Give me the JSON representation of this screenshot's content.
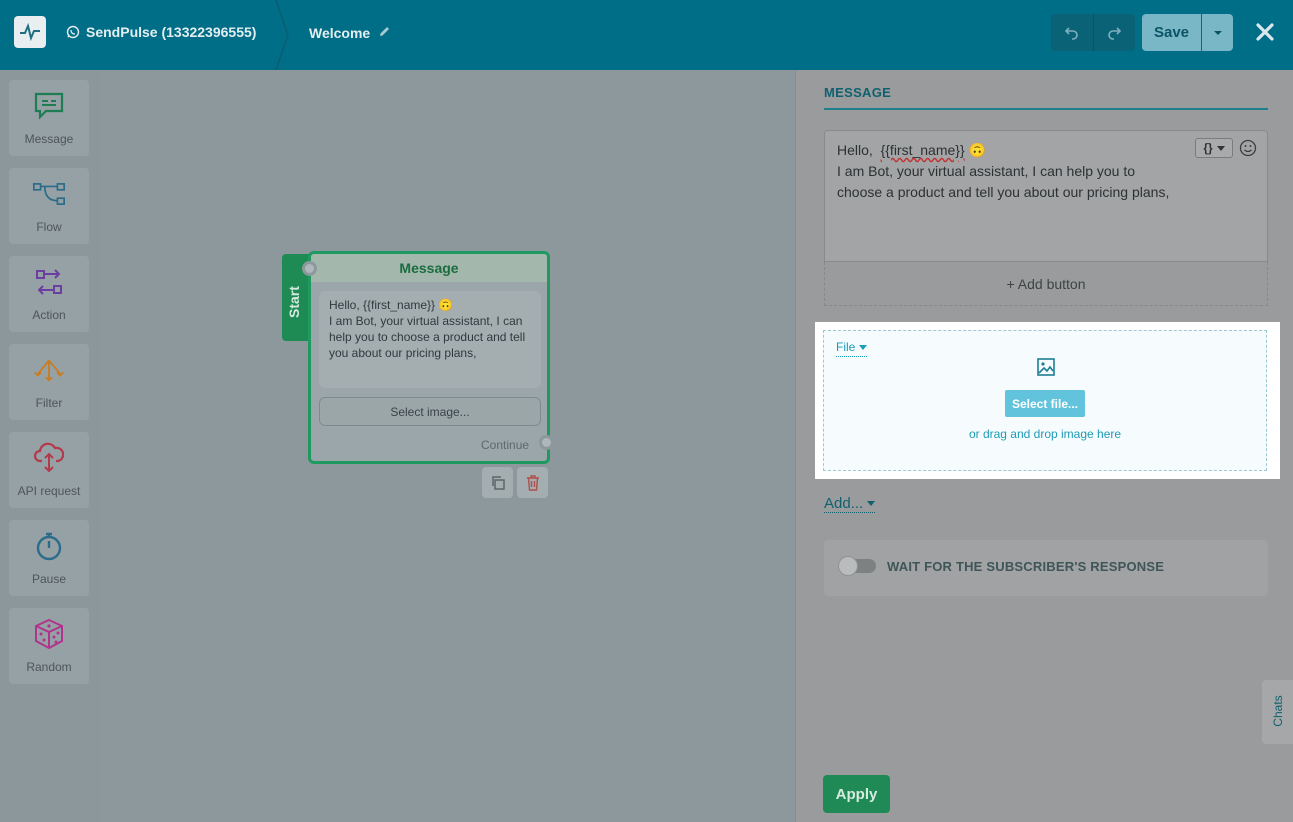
{
  "header": {
    "bot_name": "SendPulse (13322396555)",
    "flow_title": "Welcome",
    "save_label": "Save",
    "icons": [
      "pulse-logo-icon",
      "whatsapp-icon",
      "pencil-icon",
      "undo-icon",
      "redo-icon",
      "caret-down-icon",
      "close-icon"
    ]
  },
  "toolbar": {
    "items": [
      {
        "label": "Message",
        "icon": "message-icon",
        "color": "#1e7d52"
      },
      {
        "label": "Flow",
        "icon": "flow-icon",
        "color": "#2a6c8a"
      },
      {
        "label": "Action",
        "icon": "action-icon",
        "color": "#6a3fa0"
      },
      {
        "label": "Filter",
        "icon": "filter-icon",
        "color": "#c97b1e"
      },
      {
        "label": "API request",
        "icon": "api-request-icon",
        "color": "#b23a4a"
      },
      {
        "label": "Pause",
        "icon": "pause-timer-icon",
        "color": "#2a6c8a"
      },
      {
        "label": "Random",
        "icon": "dice-icon",
        "color": "#b0338d"
      }
    ]
  },
  "node": {
    "start_label": "Start",
    "title": "Message",
    "text_line1": "Hello,  {{first_name}} 🙃",
    "text_rest": "I am Bot, your virtual assistant, I can help you to choose a product and tell you about our pricing plans,",
    "select_image_label": "Select image...",
    "continue_label": "Continue"
  },
  "panel": {
    "title": "MESSAGE",
    "message": {
      "greeting": "Hello,  ",
      "variable": "{{first_name}}",
      "emoji": "🙃",
      "line2": "I am Bot, your virtual assistant, I can help you to choose a product and tell you about our pricing plans,"
    },
    "vars_button": "{}",
    "add_button_label": "+ Add button",
    "file": {
      "type_label": "File",
      "select_label": "Select file...",
      "drag_text": "or drag and drop image here"
    },
    "add_more_label": "Add...",
    "wait_label": "WAIT FOR THE SUBSCRIBER'S RESPONSE",
    "wait_enabled": false,
    "apply_label": "Apply"
  },
  "chats_tab_label": "Chats",
  "colors": {
    "header_bg": "#006e87",
    "accent_teal": "#169db9",
    "apply_green": "#1f8a55",
    "node_green": "#1e9a60"
  }
}
